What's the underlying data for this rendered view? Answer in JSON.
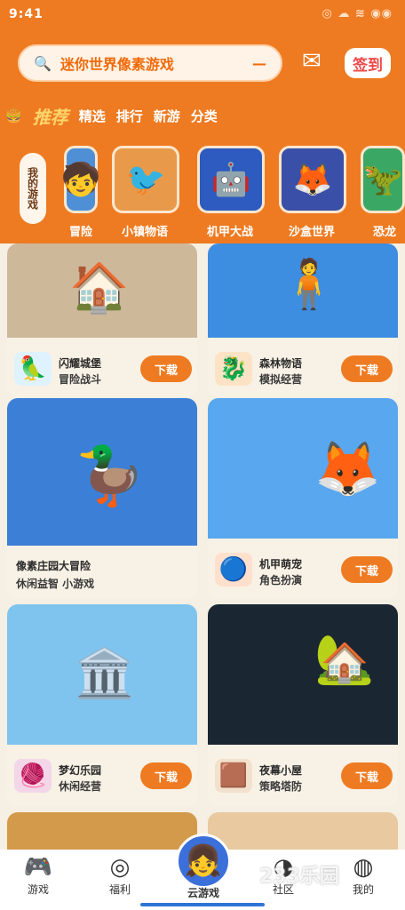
{
  "status": {
    "time": "9:41",
    "icons": "◎ ☁ ≋ ◉◉"
  },
  "search": {
    "placeholder": "迷你世界像素游戏",
    "icon": "search-icon",
    "clear": "—"
  },
  "header": {
    "message_icon": "message-icon",
    "badge": "签到"
  },
  "categories": {
    "active": "推荐",
    "items": [
      "精选",
      "排行",
      "新游",
      "分类"
    ]
  },
  "side_tab": "我的游戏",
  "games": [
    {
      "label": "冒险",
      "emoji": "🧒",
      "bg": "#4f8fd6"
    },
    {
      "label": "小镇物语",
      "emoji": "🐦",
      "bg": "#e89a4a"
    },
    {
      "label": "机甲大战",
      "emoji": "🤖",
      "bg": "#2d5bbf"
    },
    {
      "label": "沙盒世界",
      "emoji": "🦊",
      "bg": "#3a4fa8"
    },
    {
      "label": "恐龙",
      "emoji": "🦖",
      "bg": "#3aa765"
    }
  ],
  "feed": [
    {
      "shot_bg": "#cdb89a",
      "shot_emoji": "🏠",
      "icon_emoji": "🦜",
      "icon_bg": "#dff2ff",
      "title": "闪耀城堡",
      "subtitle": "冒险战斗",
      "button": "下载"
    },
    {
      "shot_bg": "#3d8de0",
      "shot_emoji": "🧍",
      "icon_emoji": "🐉",
      "icon_bg": "#fde3c6",
      "title": "森林物语",
      "subtitle": "模拟经营",
      "button": "下载"
    },
    {
      "shot_bg": "#3c7fd6",
      "shot_emoji": "🦆",
      "icon_emoji": "",
      "icon_bg": "#f6efe3",
      "title": "像素庄园大冒险",
      "subtitle": "休闲益智 小游戏",
      "button": ""
    },
    {
      "shot_bg": "#59a7ee",
      "shot_emoji": "🦊",
      "icon_emoji": "🔵",
      "icon_bg": "#ffe0cc",
      "title": "机甲萌宠",
      "subtitle": "角色扮演",
      "button": "下载"
    },
    {
      "shot_bg": "#7fc4ee",
      "shot_emoji": "🏛️",
      "icon_emoji": "🧶",
      "icon_bg": "#f3d7e8",
      "title": "梦幻乐园",
      "subtitle": "休闲经营",
      "button": "下载"
    },
    {
      "shot_bg": "#1b2633",
      "shot_emoji": "🏡",
      "icon_emoji": "🟫",
      "icon_bg": "#f2e1cc",
      "title": "夜幕小屋",
      "subtitle": "策略塔防",
      "button": "下载"
    }
  ],
  "nav": {
    "items": [
      {
        "label": "游戏",
        "icon": "gamepad-icon",
        "glyph": "🎮"
      },
      {
        "label": "福利",
        "icon": "gift-icon",
        "glyph": "◎"
      },
      {
        "label": "社区",
        "icon": "community-icon",
        "glyph": "◑"
      },
      {
        "label": "我的",
        "icon": "profile-icon",
        "glyph": "◍"
      }
    ],
    "center_label": "云游戏",
    "center_glyph": "👧"
  },
  "watermark": "233乐园"
}
